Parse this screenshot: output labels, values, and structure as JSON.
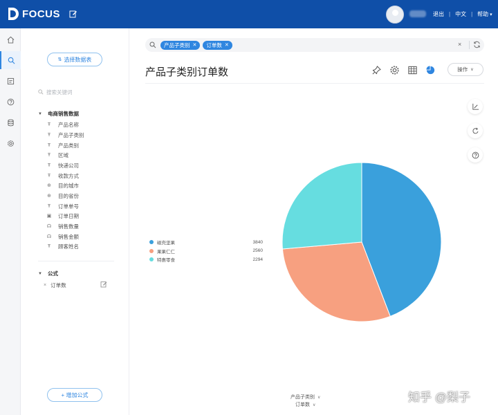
{
  "app": {
    "logo_text": "FOCUS"
  },
  "header": {
    "links": {
      "logout": "退出",
      "language": "中文",
      "help": "帮助"
    },
    "help_caret": "▾"
  },
  "rail": {
    "items": [
      "home-icon",
      "search-icon",
      "board-icon",
      "help-icon",
      "database-icon",
      "settings-icon"
    ],
    "active": "search-icon"
  },
  "panel": {
    "select_table_label": "选择数据表",
    "search_placeholder": "搜索关键词",
    "dataset_title": "电商销售数据",
    "fields": [
      {
        "label": "产品名称",
        "icon": "text-field-icon"
      },
      {
        "label": "产品子类别",
        "icon": "text-field-icon"
      },
      {
        "label": "产品类别",
        "icon": "text-field-icon"
      },
      {
        "label": "区域",
        "icon": "text-field-icon"
      },
      {
        "label": "快递公司",
        "icon": "text-field-icon"
      },
      {
        "label": "收款方式",
        "icon": "text-field-icon"
      },
      {
        "label": "目的城市",
        "icon": "globe-icon"
      },
      {
        "label": "目的省份",
        "icon": "globe-icon"
      },
      {
        "label": "订单单号",
        "icon": "text-field-icon"
      },
      {
        "label": "订单日期",
        "icon": "calendar-icon"
      },
      {
        "label": "销售数量",
        "icon": "measure-icon"
      },
      {
        "label": "销售金额",
        "icon": "measure-icon"
      },
      {
        "label": "顾客姓名",
        "icon": "text-field-icon"
      }
    ],
    "formula_title": "公式",
    "formula_item": "订单数",
    "add_formula_label": "+ 增加公式"
  },
  "search": {
    "tokens": [
      "产品子类别",
      "订单数"
    ],
    "clear": "×"
  },
  "main": {
    "title": "产品子类别订单数",
    "ops_label": "操作"
  },
  "colors": {
    "brand": "#0f4fa8",
    "accent": "#2f86e0",
    "series": [
      "#3aa0dc",
      "#f7a080",
      "#66dde0"
    ]
  },
  "chart_data": {
    "type": "pie",
    "categories": [
      "磁壳坚果",
      "果果仁仁",
      "特惠零食"
    ],
    "values": [
      3840,
      2560,
      2294
    ],
    "legend_position": "left"
  },
  "axes": {
    "x_selector": "产品子类别",
    "y_selector": "订单数"
  },
  "watermark": "知乎 @梨子"
}
